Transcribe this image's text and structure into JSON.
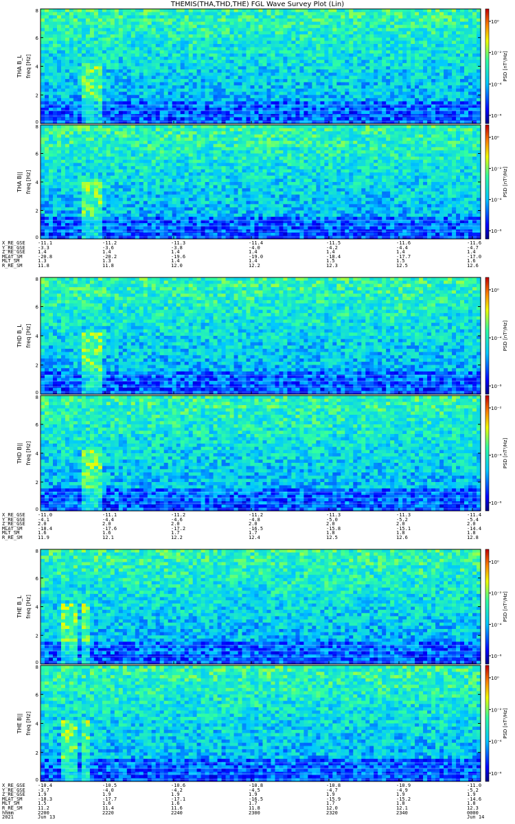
{
  "title": "THEMIS(THA,THD,THE) FGL Wave Survey Plot (Lin)",
  "chart_data": {
    "type": "heatmap",
    "x": [
      "2200",
      "2220",
      "2240",
      "2300",
      "2320",
      "2340",
      "0000"
    ],
    "ylim": [
      0,
      8
    ],
    "yticks": [
      "0",
      "2",
      "4",
      "6",
      "8"
    ],
    "ylabel": "freq [Hz]",
    "colorbar_label": "PSD [nT²/Hz]",
    "color_scale": "log",
    "panels": [
      {
        "name": "THA B_L",
        "colorbar_ticks": [
          "10⁰",
          "10⁻²",
          "10⁻⁴",
          "10⁻⁶"
        ]
      },
      {
        "name": "THA B||",
        "colorbar_ticks": [
          "10⁰",
          "10⁻²",
          "10⁻⁴",
          "10⁻⁶"
        ]
      },
      {
        "name": "THD B_L",
        "colorbar_ticks": [
          "10⁰",
          "10⁻⁴",
          "10⁻⁸"
        ]
      },
      {
        "name": "THD B||",
        "colorbar_ticks": [
          "10⁻²",
          "10⁻⁴",
          "10⁻⁶"
        ]
      },
      {
        "name": "THE B_L",
        "colorbar_ticks": [
          "10⁰",
          "10⁻²",
          "10⁻⁴",
          "10⁻⁶"
        ]
      },
      {
        "name": "THE B||",
        "colorbar_ticks": [
          "10⁰",
          "10⁻²",
          "10⁻⁴",
          "10⁻⁶"
        ]
      }
    ],
    "ephemeris": [
      {
        "labels": [
          "X_RE_GSE",
          "Y_RE_GSE",
          "Z_RE_GSE",
          "MLAT_SM",
          "MLT_SM",
          "R_RE_SM"
        ],
        "rows": [
          [
            "-11.1",
            "-11.2",
            "-11.3",
            "-11.4",
            "-11.5",
            "-11.6",
            "-11.6"
          ],
          [
            "-3.3",
            "-3.6",
            "-3.8",
            "-4.0",
            "-4.2",
            "-4.4",
            "-4.7"
          ],
          [
            "1.4",
            "1.4",
            "1.4",
            "1.4",
            "1.4",
            "1.4",
            "1.4"
          ],
          [
            "-20.8",
            "-20.2",
            "-19.6",
            "-19.0",
            "-18.4",
            "-17.7",
            "-17.0"
          ],
          [
            "1.3",
            "1.3",
            "1.4",
            "1.4",
            "1.5",
            "1.5",
            "1.6"
          ],
          [
            "11.8",
            "11.8",
            "12.0",
            "12.2",
            "12.3",
            "12.5",
            "12.6"
          ]
        ]
      },
      {
        "labels": [
          "X_RE_GSE",
          "Y_RE_GSE",
          "Z_RE_GSE",
          "MLAT_SM",
          "MLT_SM",
          "R_RE_SM"
        ],
        "rows": [
          [
            "-11.0",
            "-11.1",
            "-11.2",
            "-11.2",
            "-11.3",
            "-11.3",
            "-11.4"
          ],
          [
            "-4.1",
            "-4.4",
            "-4.6",
            "-4.8",
            "-5.0",
            "-5.2",
            "-5.4"
          ],
          [
            "2.0",
            "2.0",
            "2.0",
            "2.0",
            "2.0",
            "2.0",
            "2.0"
          ],
          [
            "-18.4",
            "-17.6",
            "-17.2",
            "-16.5",
            "-15.8",
            "-15.1",
            "-14.4"
          ],
          [
            "1.6",
            "1.6",
            "1.7",
            "1.7",
            "1.8",
            "1.8",
            "1.8"
          ],
          [
            "11.9",
            "12.1",
            "12.2",
            "12.4",
            "12.5",
            "12.6",
            "12.8"
          ]
        ]
      },
      {
        "labels": [
          "X_RE_GSE",
          "Y_RE_GSE",
          "Z_RE_GSE",
          "MLAT_SM",
          "MLT_SM",
          "R_RE_SM",
          "hhmm",
          "2021"
        ],
        "rows": [
          [
            "-10.4",
            "-10.5",
            "-10.6",
            "-10.8",
            "-10.8",
            "-10.9",
            "-11.0"
          ],
          [
            "-3.7",
            "-4.0",
            "-4.2",
            "-4.5",
            "-4.7",
            "-4.9",
            "-5.2"
          ],
          [
            "1.9",
            "1.9",
            "1.9",
            "1.9",
            "1.9",
            "1.9",
            "1.9"
          ],
          [
            "-18.3",
            "-17.7",
            "-17.1",
            "-16.5",
            "-15.9",
            "-15.2",
            "-14.6"
          ],
          [
            "1.5",
            "1.6",
            "1.6",
            "1.7",
            "1.7",
            "1.8",
            "1.8"
          ],
          [
            "11.2",
            "11.4",
            "11.6",
            "11.8",
            "12.0",
            "12.1",
            "12.3"
          ],
          [
            "2200",
            "2220",
            "2240",
            "2300",
            "2320",
            "2340",
            "0000"
          ],
          [
            "Jun 13",
            "",
            "",
            "",
            "",
            "",
            "Jun 14"
          ]
        ]
      }
    ]
  }
}
